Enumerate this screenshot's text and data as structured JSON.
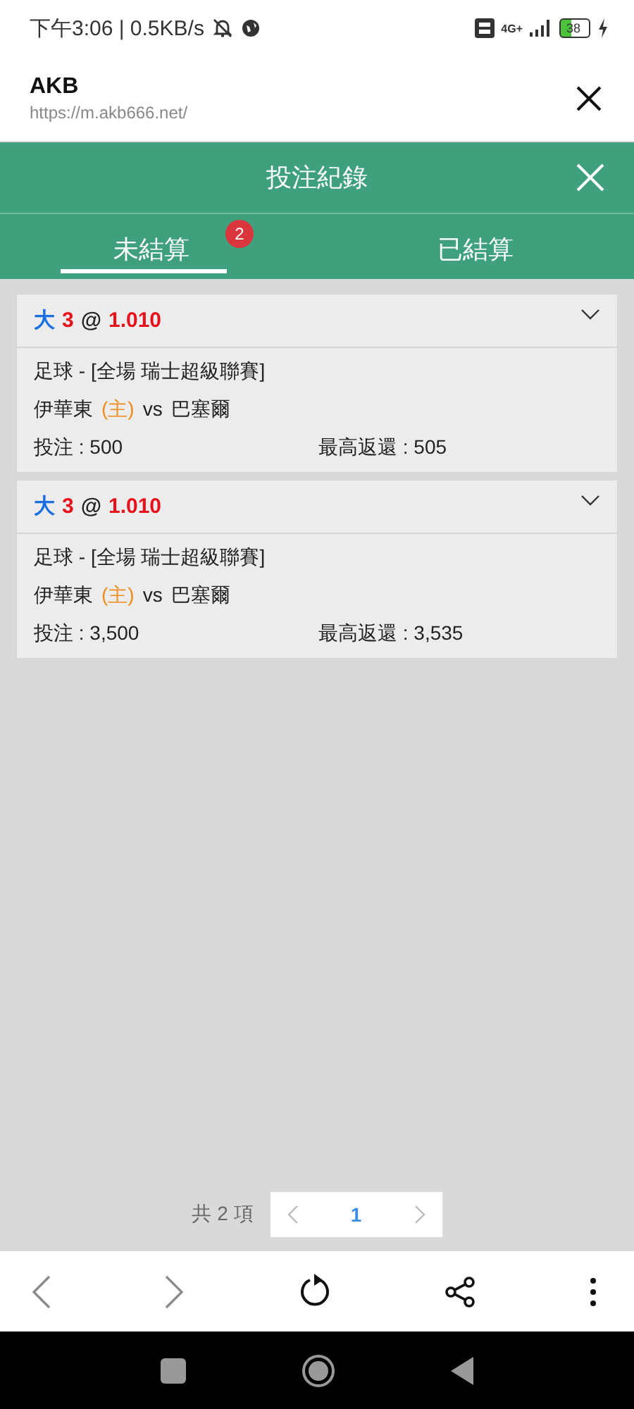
{
  "status_bar": {
    "time": "下午3:06 | 0.5KB/s",
    "network": "4G+",
    "battery": "38"
  },
  "browser": {
    "title": "AKB",
    "url": "https://m.akb666.net/"
  },
  "header": {
    "title": "投注紀錄"
  },
  "tabs": [
    {
      "label": "未結算",
      "selected": true,
      "badge": "2"
    },
    {
      "label": "已結算",
      "selected": false
    }
  ],
  "bets": [
    {
      "pick": "大",
      "line": "3",
      "at": "@",
      "odds": "1.010",
      "league": "足球 - [全場 瑞士超級聯賽]",
      "home": "伊華東",
      "home_tag": "(主)",
      "vs": "vs",
      "away": "巴塞爾",
      "stake": "投注 : 500",
      "max_return": "最高返還 : 505",
      "expanded": false
    },
    {
      "pick": "大",
      "line": "3",
      "at": "@",
      "odds": "1.010",
      "league": "足球 - [全場 瑞士超級聯賽]",
      "home": "伊華東",
      "home_tag": "(主)",
      "vs": "vs",
      "away": "巴塞爾",
      "stake": "投注 : 3,500",
      "max_return": "最高返還 : 3,535",
      "expanded": false
    }
  ],
  "pagination": {
    "total": "共 2 項",
    "current": "1"
  }
}
